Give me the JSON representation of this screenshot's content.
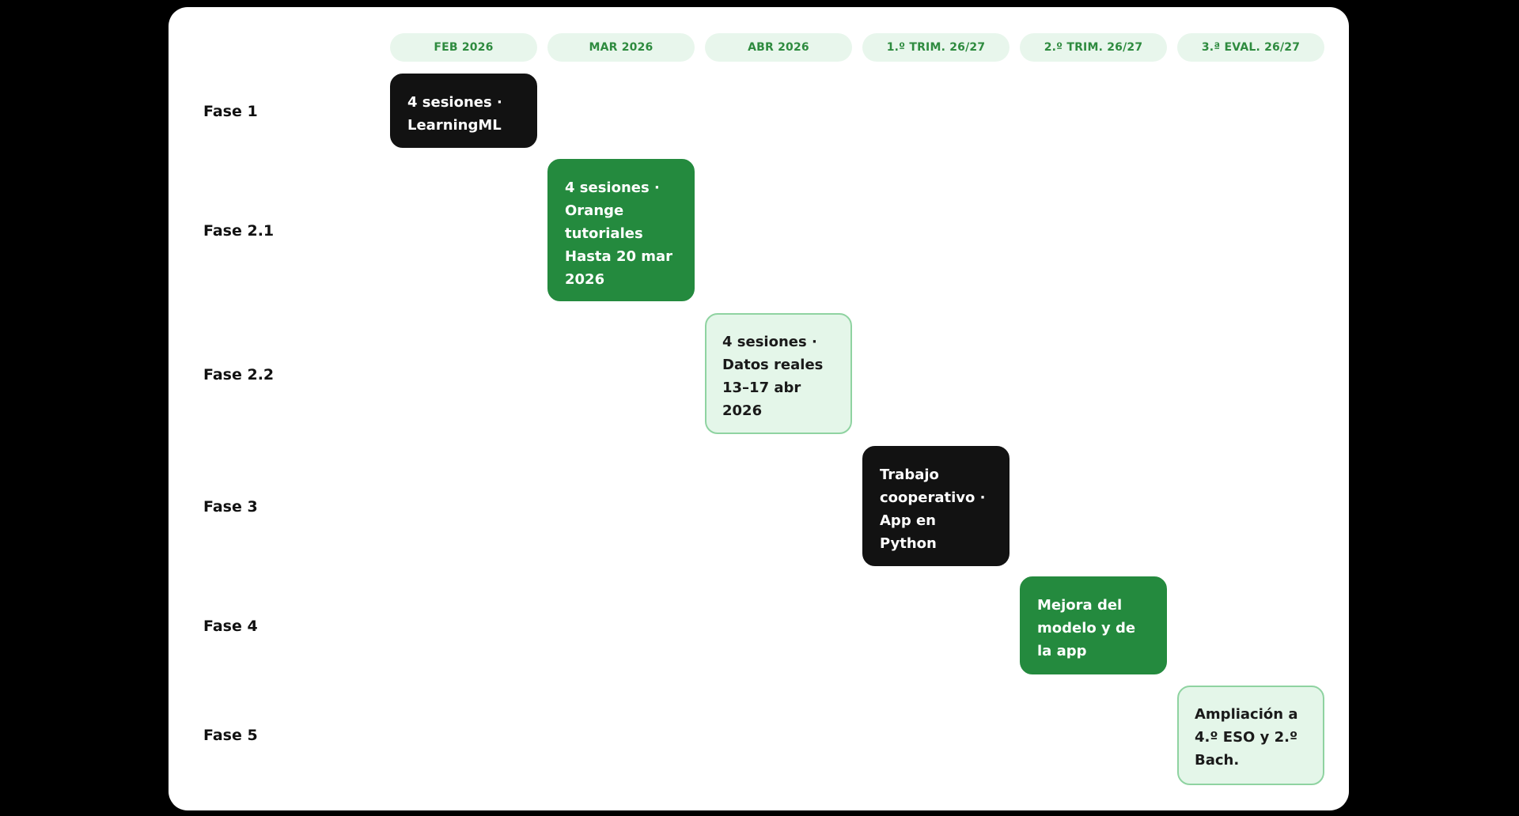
{
  "columns": [
    {
      "label": "FEB 2026"
    },
    {
      "label": "MAR 2026"
    },
    {
      "label": "ABR 2026"
    },
    {
      "label": "1.º TRIM. 26/27"
    },
    {
      "label": "2.º TRIM. 26/27"
    },
    {
      "label": "3.ª EVAL. 26/27"
    }
  ],
  "rows": [
    {
      "label": "Fase 1"
    },
    {
      "label": "Fase 2.1"
    },
    {
      "label": "Fase 2.2"
    },
    {
      "label": "Fase 3"
    },
    {
      "label": "Fase 4"
    },
    {
      "label": "Fase 5"
    }
  ],
  "tasks": [
    {
      "style": "dark",
      "lines": [
        "4 sesiones ·",
        "LearningML"
      ]
    },
    {
      "style": "green",
      "lines": [
        "4 sesiones ·",
        "Orange",
        "tutoriales",
        "Hasta 20 mar",
        "2026"
      ]
    },
    {
      "style": "light",
      "lines": [
        "4 sesiones ·",
        "Datos reales",
        "13–17 abr",
        "2026"
      ]
    },
    {
      "style": "dark",
      "lines": [
        "Trabajo",
        "cooperativo ·",
        "App en",
        "Python"
      ]
    },
    {
      "style": "green",
      "lines": [
        "Mejora del",
        "modelo y de",
        "la app"
      ]
    },
    {
      "style": "light",
      "lines": [
        "Ampliación a",
        "4.º ESO y 2.º",
        "Bach."
      ]
    }
  ],
  "colors": {
    "background": "#000000",
    "card": "#ffffff",
    "header_bg": "#e8f6ec",
    "header_text": "#2e8b3f",
    "dark": "#121212",
    "green": "#248a3e",
    "light_bg": "#e4f6e9",
    "light_border": "#8fd3a1"
  }
}
